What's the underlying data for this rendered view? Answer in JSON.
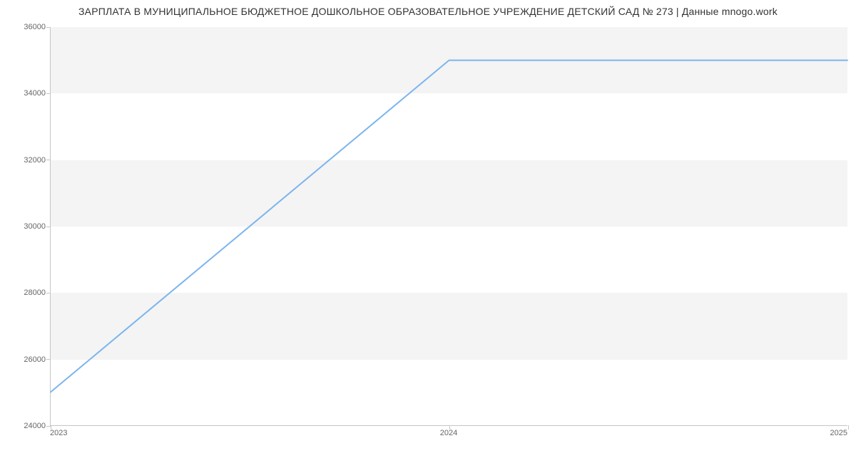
{
  "title": "ЗАРПЛАТА В МУНИЦИПАЛЬНОЕ БЮДЖЕТНОЕ ДОШКОЛЬНОЕ ОБРАЗОВАТЕЛЬНОЕ УЧРЕЖДЕНИЕ ДЕТСКИЙ САД № 273 | Данные mnogo.work",
  "chart_data": {
    "type": "line",
    "x": [
      2023,
      2024,
      2025
    ],
    "values": [
      25000,
      35000,
      35000
    ],
    "title": "ЗАРПЛАТА В МУНИЦИПАЛЬНОЕ БЮДЖЕТНОЕ ДОШКОЛЬНОЕ ОБРАЗОВАТЕЛЬНОЕ УЧРЕЖДЕНИЕ ДЕТСКИЙ САД № 273 | Данные mnogo.work",
    "xlabel": "",
    "ylabel": "",
    "xlim": [
      2023,
      2025
    ],
    "ylim": [
      24000,
      36000
    ],
    "yticks": [
      24000,
      26000,
      28000,
      30000,
      32000,
      34000,
      36000
    ],
    "xticks": [
      2023,
      2024,
      2025
    ],
    "line_color": "#7cb5ec"
  }
}
